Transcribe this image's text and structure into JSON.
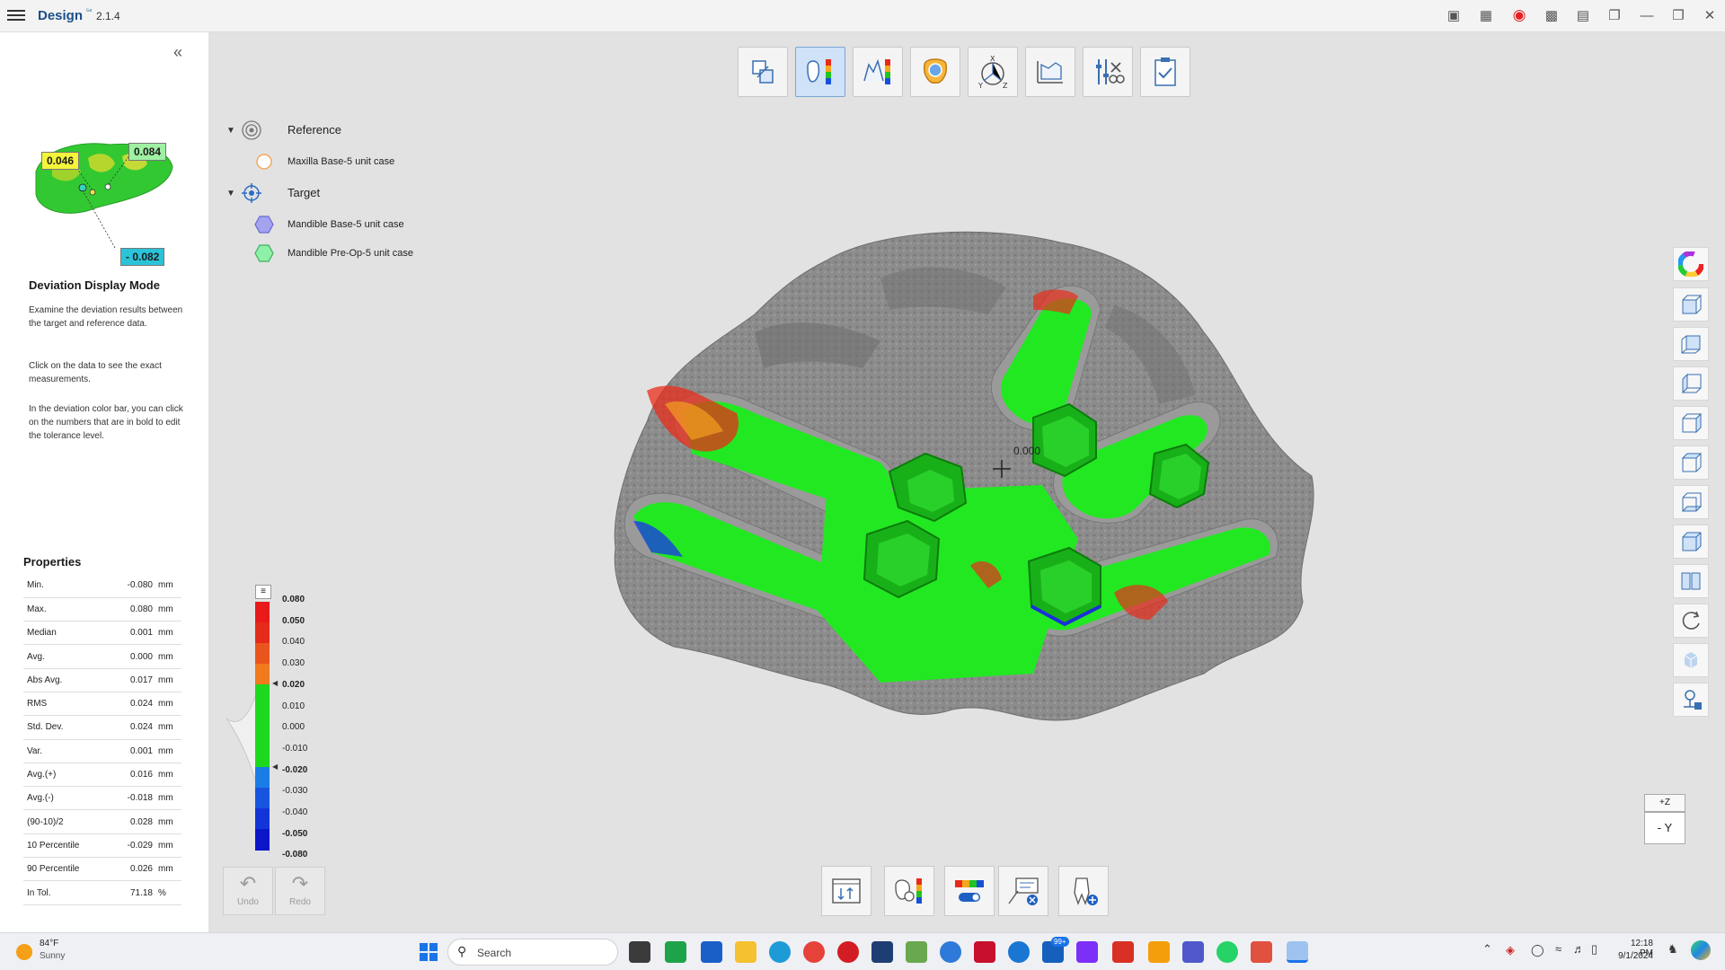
{
  "app": {
    "title": "Design",
    "superscript": "⁵ᵉ",
    "version": "2.1.4"
  },
  "thumbnail": {
    "tag_yellow": "0.046",
    "tag_green": "0.084",
    "tag_cyan": "- 0.082"
  },
  "panel": {
    "mode_title": "Deviation Display Mode",
    "desc1": "Examine the deviation results between the target and reference data.",
    "desc2": "Click on the data to see the exact measurements.",
    "desc3": "In the deviation color bar, you can click on the numbers that are in bold to edit the tolerance level.",
    "properties_title": "Properties",
    "properties": [
      {
        "label": "Min.",
        "value": "-0.080",
        "unit": "mm"
      },
      {
        "label": "Max.",
        "value": "0.080",
        "unit": "mm"
      },
      {
        "label": "Median",
        "value": "0.001",
        "unit": "mm"
      },
      {
        "label": "Avg.",
        "value": "0.000",
        "unit": "mm"
      },
      {
        "label": "Abs Avg.",
        "value": "0.017",
        "unit": "mm"
      },
      {
        "label": "RMS",
        "value": "0.024",
        "unit": "mm"
      },
      {
        "label": "Std. Dev.",
        "value": "0.024",
        "unit": "mm"
      },
      {
        "label": "Var.",
        "value": "0.001",
        "unit": "mm"
      },
      {
        "label": "Avg.(+)",
        "value": "0.016",
        "unit": "mm"
      },
      {
        "label": "Avg.(-)",
        "value": "-0.018",
        "unit": "mm"
      },
      {
        "label": "(90-10)/2",
        "value": "0.028",
        "unit": "mm"
      },
      {
        "label": "10 Percentile",
        "value": "-0.029",
        "unit": "mm"
      },
      {
        "label": "90 Percentile",
        "value": "0.026",
        "unit": "mm"
      },
      {
        "label": "In Tol.",
        "value": "71.18",
        "unit": "%"
      }
    ]
  },
  "tree": {
    "reference_label": "Reference",
    "reference_item": "Maxilla Base-5 unit case",
    "target_label": "Target",
    "target_items": [
      "Mandible Base-5 unit case",
      "Mandible Pre-Op-5 unit case"
    ]
  },
  "colorbar": {
    "labels": [
      "0.080",
      "0.050",
      "0.040",
      "0.030",
      "0.020",
      "0.010",
      "0.000",
      "-0.010",
      "-0.020",
      "-0.030",
      "-0.040",
      "-0.050",
      "-0.080"
    ],
    "bold": [
      true,
      true,
      false,
      false,
      true,
      false,
      false,
      false,
      true,
      false,
      false,
      true,
      true
    ],
    "colors": [
      "#e81a1a",
      "#e52b1a",
      "#e9551c",
      "#f07a1c",
      "#1ed81e",
      "#1ed81e",
      "#1ed81e",
      "#1ed81e",
      "#1a7de6",
      "#1755e0",
      "#1235d8",
      "#0b16c8"
    ]
  },
  "viewport": {
    "measurement": "0.000"
  },
  "undo": {
    "label": "Undo"
  },
  "redo": {
    "label": "Redo"
  },
  "viewcube": {
    "top": "+Z",
    "front": "- Y"
  },
  "taskbar": {
    "weather_temp": "84°F",
    "weather_desc": "Sunny",
    "search_placeholder": "Search",
    "badge": "99+",
    "time": "12:18 PM",
    "date": "9/1/2024"
  }
}
